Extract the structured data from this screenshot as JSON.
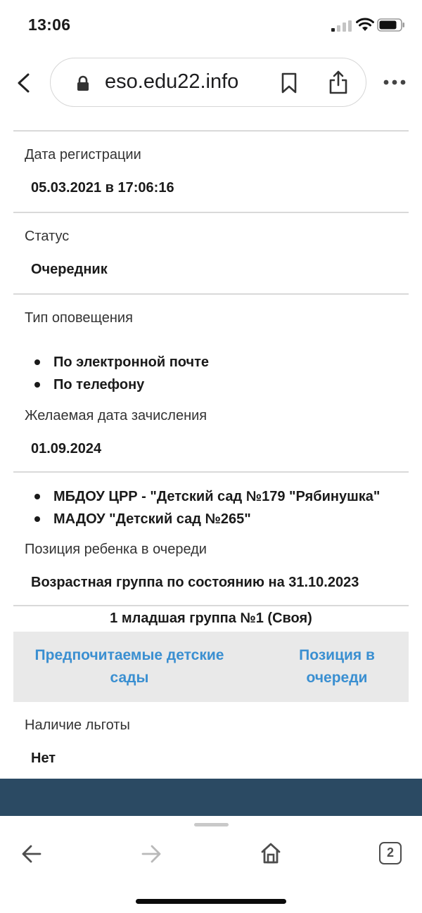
{
  "status_bar": {
    "time": "13:06"
  },
  "browser": {
    "url": "eso.edu22.info"
  },
  "fields": {
    "registration_date": {
      "label": "Дата регистрации",
      "value": "05.03.2021 в 17:06:16"
    },
    "status": {
      "label": "Статус",
      "value": "Очередник"
    },
    "notification_type": {
      "label": "Тип оповещения",
      "items": [
        "По электронной почте",
        "По телефону"
      ]
    },
    "desired_enrollment_date": {
      "label": "Желаемая дата зачисления",
      "value": "01.09.2024"
    },
    "kindergartens": {
      "items": [
        "МБДОУ ЦРР - \"Детский сад №179 \"Рябинушка\"",
        "МАДОУ \"Детский сад №265\""
      ]
    },
    "queue_position": {
      "label": "Позиция ребенка в очереди",
      "value": "Возрастная группа по состоянию на 31.10.2023"
    },
    "group": {
      "value": "1 младшая группа №1 (Своя)"
    },
    "tabs": {
      "preferred_line1": "Предпочитаемые детские",
      "preferred_line2": "сады",
      "position_line1": "Позиция в",
      "position_line2": "очереди"
    },
    "benefit": {
      "label": "Наличие льготы",
      "value": "Нет"
    }
  },
  "toolbar": {
    "tabs_count": "2"
  },
  "colors": {
    "link": "#3a8fd1",
    "band": "#2b4a63",
    "panel": "#e9e9e9"
  }
}
